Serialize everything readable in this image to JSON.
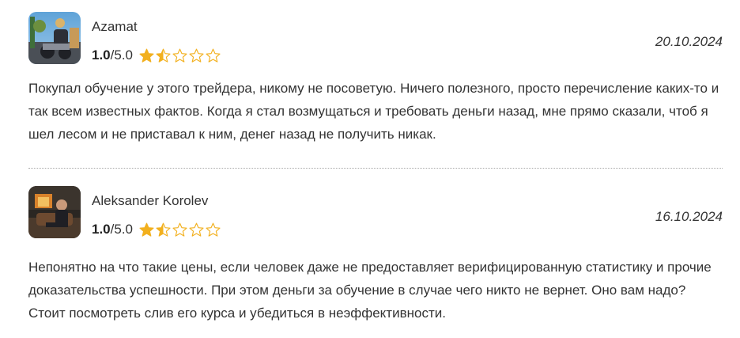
{
  "reviews": [
    {
      "author": "Azamat",
      "score": "1.0",
      "max": "/5.0",
      "stars_filled": 1.5,
      "date": "20.10.2024",
      "text": "Покупал обучение у этого трейдера, никому не посоветую. Ничего полезного, просто перечисление каких-то и так всем известных фактов. Когда я стал возмущаться и требовать деньги назад, мне прямо сказали, чтоб я шел лесом и не приставал к ним, денег назад не получить никак."
    },
    {
      "author": "Aleksander Korolev",
      "score": "1.0",
      "max": "/5.0",
      "stars_filled": 1.5,
      "date": "16.10.2024",
      "text": "Непонятно на что такие цены, если человек даже не предоставляет верифицированную статистику и прочие доказательства успешности. При этом деньги за обучение в случае чего никто не вернет. Оно вам надо? Стоит посмотреть слив его курса и убедиться в неэффективности."
    }
  ],
  "colors": {
    "star": "#f2b01e",
    "text": "#333333",
    "divider": "#a8a8a8"
  }
}
